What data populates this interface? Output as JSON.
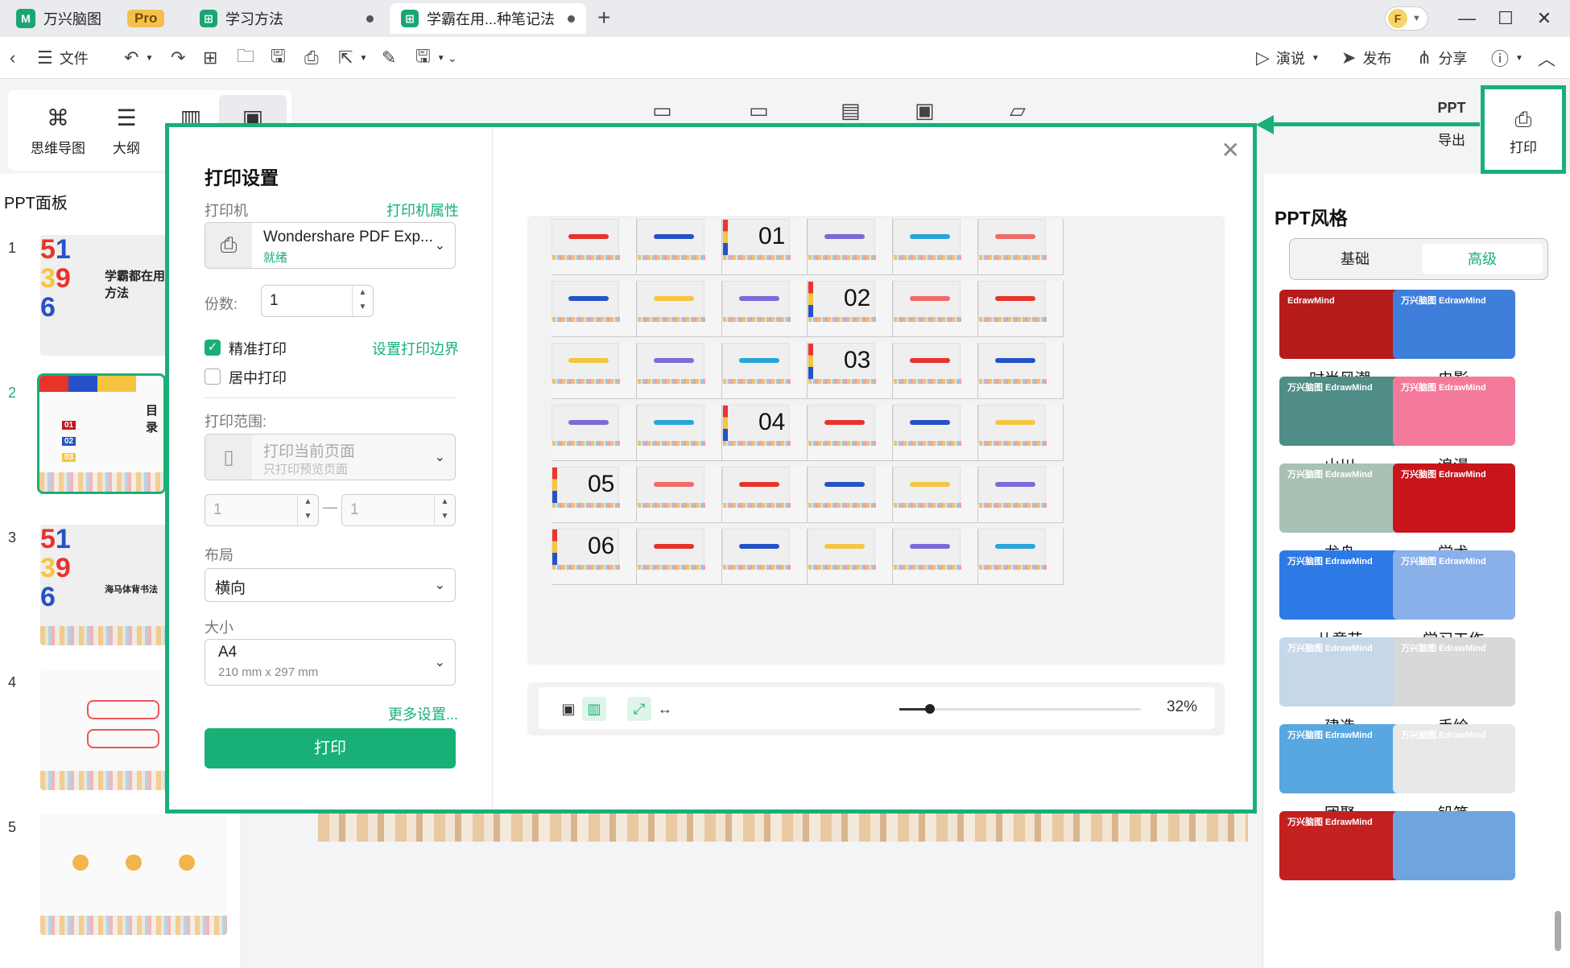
{
  "titlebar": {
    "app_name": "万兴脑图",
    "pro_badge": "Pro",
    "tabs": [
      {
        "label": "学习方法"
      },
      {
        "label": "学霸在用...种笔记法"
      }
    ],
    "avatar_letter": "F"
  },
  "menubar": {
    "file": "文件",
    "present": "演说",
    "publish": "发布",
    "share": "分享"
  },
  "ribbon": {
    "mindmap": "思维导图",
    "outline": "大纲",
    "export": "导出",
    "print": "打印"
  },
  "left_panel": {
    "title": "PPT面板",
    "slides": [
      {
        "num": "1",
        "title": "学霸都在用方法"
      },
      {
        "num": "2",
        "title": "目录",
        "items": [
          "01",
          "02",
          "03"
        ]
      },
      {
        "num": "3",
        "title": "海马体背书法"
      },
      {
        "num": "4"
      },
      {
        "num": "5"
      }
    ]
  },
  "right_panel": {
    "title": "PPT风格",
    "tabs": {
      "basic": "基础",
      "advanced": "高级"
    },
    "styles": [
      {
        "name": "时尚风潮",
        "brand": "EdrawMind",
        "color": "#b51b1b"
      },
      {
        "name": "电影",
        "brand": "万兴脑图 EdrawMind",
        "color": "#3f7fdc"
      },
      {
        "name": "山川",
        "brand": "万兴脑图 EdrawMind",
        "color": "#4f8d86"
      },
      {
        "name": "浪漫",
        "brand": "万兴脑图 EdrawMind",
        "color": "#f37a9a"
      },
      {
        "name": "龙舟",
        "brand": "万兴脑图 EdrawMind",
        "color": "#a9c1b4"
      },
      {
        "name": "学术",
        "brand": "万兴脑图 EdrawMind",
        "color": "#c8151b"
      },
      {
        "name": "儿童节",
        "brand": "万兴脑图 EdrawMind",
        "color": "#2d7ae6"
      },
      {
        "name": "学习工作",
        "brand": "万兴脑图 EdrawMind",
        "color": "#8ab0ea"
      },
      {
        "name": "建造",
        "brand": "万兴脑图 EdrawMind",
        "color": "#c6d7ea"
      },
      {
        "name": "手绘",
        "brand": "万兴脑图 EdrawMind",
        "color": "#d8d8d8"
      },
      {
        "name": "团聚",
        "brand": "万兴脑图 EdrawMind",
        "color": "#59a7e0"
      },
      {
        "name": "铅笔",
        "brand": "万兴脑图 EdrawMind",
        "color": "#e8e8e8"
      },
      {
        "name": "",
        "brand": "万兴脑图 EdrawMind",
        "color": "#c3211f"
      },
      {
        "name": "",
        "brand": "",
        "color": "#6ea5df"
      }
    ]
  },
  "dialog": {
    "title": "打印设置",
    "printer_label": "打印机",
    "printer_props": "打印机属性",
    "printer_name": "Wondershare PDF Exp...",
    "printer_status": "就绪",
    "copies_label": "份数:",
    "copies_value": "1",
    "precise_print": "精准打印",
    "set_margins": "设置打印边界",
    "center_print": "居中打印",
    "range_label": "打印范围:",
    "range_main": "打印当前页面",
    "range_sub": "只打印预览页面",
    "range_from": "1",
    "range_to": "1",
    "range_dash": "—",
    "layout_label": "布局",
    "layout_value": "横向",
    "size_label": "大小",
    "size_value": "A4",
    "size_sub": "210 mm x 297 mm",
    "more_settings": "更多设置...",
    "print_button": "打印",
    "zoom": "32%",
    "zoom_fraction": 0.05,
    "preview_page_numbers": [
      "01",
      "02",
      "03",
      "04",
      "05",
      "06"
    ]
  },
  "canvas": {}
}
